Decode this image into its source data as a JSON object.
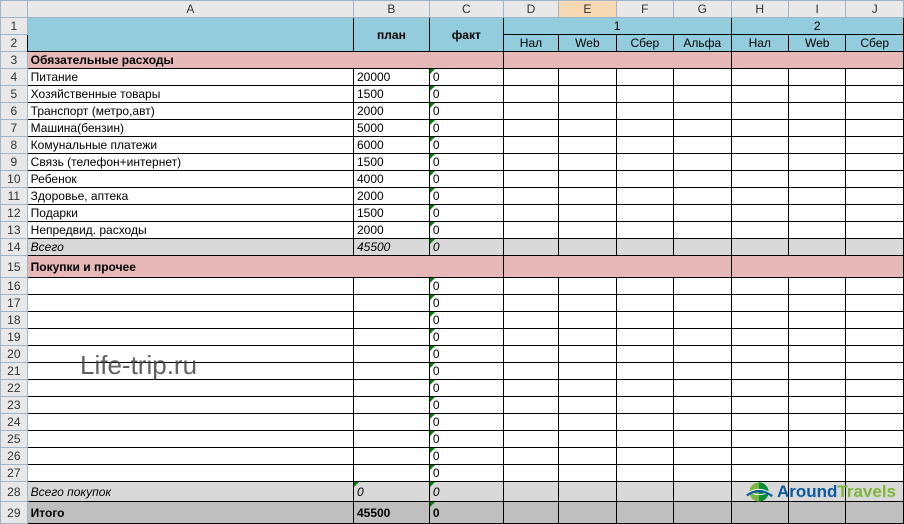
{
  "columns": [
    "A",
    "B",
    "C",
    "D",
    "E",
    "F",
    "G",
    "H",
    "I",
    "J"
  ],
  "header": {
    "plan": "план",
    "fact": "факт",
    "group1": "1",
    "group2": "2",
    "sub": {
      "nal": "Нал",
      "web": "Web",
      "sber": "Сбер",
      "alfa": "Альфа"
    }
  },
  "sections": {
    "mandatory": "Обязательные расходы",
    "purchases": "Покупки и прочее",
    "total_purchases": "Всего покупок",
    "subtotal": "Всего",
    "grand_total": "Итого"
  },
  "rows": [
    {
      "label": "Питание",
      "plan": "20000",
      "fact": "0"
    },
    {
      "label": "Хозяйственные товары",
      "plan": "1500",
      "fact": "0"
    },
    {
      "label": "Транспорт (метро,авт)",
      "plan": "2000",
      "fact": "0"
    },
    {
      "label": "Машина(бензин)",
      "plan": "5000",
      "fact": "0"
    },
    {
      "label": "Комунальные платежи",
      "plan": "6000",
      "fact": "0"
    },
    {
      "label": "Связь (телефон+интернет)",
      "plan": "1500",
      "fact": "0"
    },
    {
      "label": "Ребенок",
      "plan": "4000",
      "fact": "0"
    },
    {
      "label": "Здоровье, аптека",
      "plan": "2000",
      "fact": "0"
    },
    {
      "label": "Подарки",
      "plan": "1500",
      "fact": "0"
    },
    {
      "label": "Непредвид. расходы",
      "plan": "2000",
      "fact": "0"
    }
  ],
  "subtotal": {
    "plan": "45500",
    "fact": "0"
  },
  "purchases_fact_default": "0",
  "total_purchases": {
    "plan": "0",
    "fact": "0"
  },
  "grand_total": {
    "plan": "45500",
    "fact": "0"
  },
  "watermark": "Life-trip.ru",
  "logo": {
    "around": "Around",
    "travels": "Travels"
  }
}
